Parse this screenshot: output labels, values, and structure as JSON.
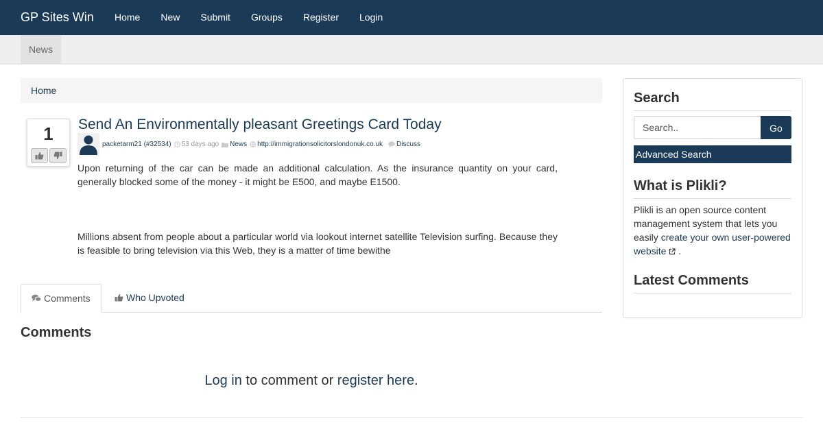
{
  "nav": {
    "brand": "GP Sites Win",
    "links": [
      "Home",
      "New",
      "Submit",
      "Groups",
      "Register",
      "Login"
    ]
  },
  "category_bar": {
    "active": "News"
  },
  "breadcrumb": {
    "home": "Home"
  },
  "story": {
    "votes": "1",
    "title": "Send An Environmentally pleasant Greetings Card Today",
    "author": "packetarm21 (#32534)",
    "time": "53 days ago",
    "category": "News",
    "url": "http://immigrationsolicitorslondonuk.co.uk",
    "discuss": "Discuss",
    "paragraph1": "Upon returning of the car can be made an additional calculation. As the insurance quantity on your card, generally blocked some of the money - it might be E500, and maybe E1500.",
    "paragraph2": "Millions absent from people about a particular world via lookout internet satellite Television surfing. Because they is feasible to bring television via this Web, they is a matter of time bewithe"
  },
  "tabs": {
    "comments": "Comments",
    "who_upvoted": "Who Upvoted"
  },
  "comments": {
    "heading": "Comments",
    "login_link": "Log in",
    "middle": " to comment or ",
    "register_link": "register here",
    "end": "."
  },
  "sidebar": {
    "search_heading": "Search",
    "search_placeholder": "Search..",
    "go_label": "Go",
    "advanced_search": "Advanced Search",
    "what_heading": "What is Plikli?",
    "about_text": "Plikli is an open source content management system that lets you easily ",
    "about_link": "create your own user-powered website",
    "about_end": " .",
    "latest_heading": "Latest Comments"
  },
  "colors": {
    "brand": "#1b3a57",
    "light_bar": "#eeeeee"
  },
  "icons": [
    "thumbs-up-icon",
    "thumbs-down-icon",
    "user-avatar-icon",
    "clock-icon",
    "folder-icon",
    "link-icon",
    "comment-icon",
    "external-link-icon"
  ]
}
